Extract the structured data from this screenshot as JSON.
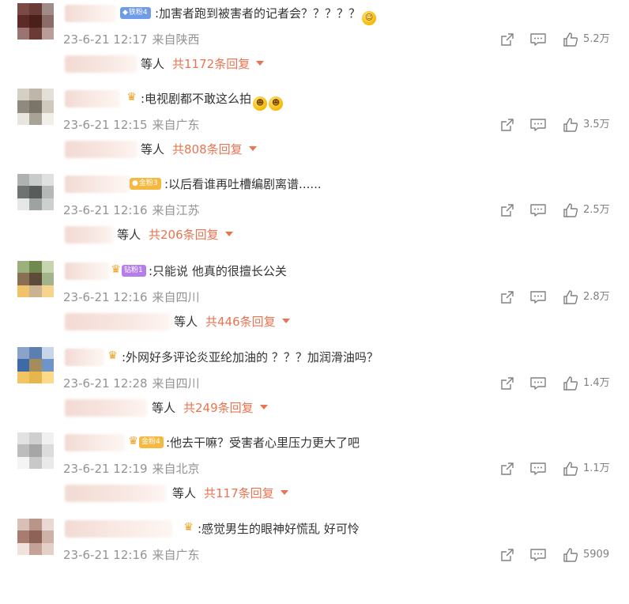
{
  "comments": [
    {
      "badge": "铁粉4",
      "badge_color": "#6f9be8",
      "badge_has_crown": false,
      "crown_only": false,
      "text": ":加害者跑到被害者的记者会？？？？？",
      "emoji": "grinning-sweat-emoji",
      "date": "23-6-21 12:17",
      "location": "来自陕西",
      "likes": "5.2万",
      "reply_prefix": "等人",
      "reply_link": "共1172条回复",
      "avatar": [
        "#7b4a44",
        "#6a3a36",
        "#a08b87",
        "#5c2b28",
        "#4b1f1c",
        "#8c6c68",
        "#9a7470",
        "#6b3a35",
        "#b89d98"
      ]
    },
    {
      "badge": "",
      "badge_color": "",
      "badge_has_crown": false,
      "crown_only": true,
      "text": ":电视剧都不敢这么拍",
      "emoji": "laughing-crying-emoji",
      "date": "23-6-21 12:15",
      "location": "来自广东",
      "likes": "3.5万",
      "reply_prefix": "等人",
      "reply_link": "共808条回复",
      "avatar": [
        "#d6d0c4",
        "#bdb6a9",
        "#e4e0d8",
        "#8f8a80",
        "#7a7568",
        "#cfc9bd",
        "#e9e6e0",
        "#a9a396",
        "#f2efea"
      ]
    },
    {
      "badge": "金粉3",
      "badge_color": "#f5b940",
      "badge_has_crown": false,
      "crown_only": false,
      "text": ":以后看谁再吐槽编剧离谱......",
      "emoji": "",
      "date": "23-6-21 12:16",
      "location": "来自江苏",
      "likes": "2.5万",
      "reply_prefix": "等人",
      "reply_link": "共206条回复",
      "avatar": [
        "#aeb2b0",
        "#c9ccca",
        "#dfe1e0",
        "#6f7472",
        "#585d5b",
        "#b4b8b6",
        "#e6e8e7",
        "#9ea3a1",
        "#cdd0cf"
      ]
    },
    {
      "badge": "钻粉1",
      "badge_color": "#b57ee8",
      "badge_has_crown": true,
      "crown_only": false,
      "text": ":只能说 他真的很擅长公关",
      "emoji": "",
      "date": "23-6-21 12:16",
      "location": "来自四川",
      "likes": "2.8万",
      "reply_prefix": "等人",
      "reply_link": "共446条回复",
      "avatar": [
        "#9bb07a",
        "#6f8a4c",
        "#c7d4b0",
        "#8a6f55",
        "#5e4a38",
        "#a3b48a",
        "#f0c36a",
        "#c9b392",
        "#f6d48c"
      ]
    },
    {
      "badge": "",
      "badge_color": "",
      "badge_has_crown": false,
      "crown_only": true,
      "text": ":外网好多评论炎亚纶加油的 ？？？加润滑油吗？",
      "emoji": "",
      "date": "23-6-21 12:28",
      "location": "来自四川",
      "likes": "1.4万",
      "reply_prefix": "等人",
      "reply_link": "共249条回复",
      "avatar": [
        "#8aa3c8",
        "#5d7fb0",
        "#c9d6e8",
        "#3f6aa8",
        "#a48d5c",
        "#6f94c8",
        "#f2c462",
        "#e6b64c",
        "#ffd98a"
      ]
    },
    {
      "badge": "金粉4",
      "badge_color": "#f5b940",
      "badge_has_crown": true,
      "crown_only": false,
      "text": ":他去干嘛？受害者心里压力更大了吧",
      "emoji": "",
      "date": "23-6-21 12:19",
      "location": "来自北京",
      "likes": "1.1万",
      "reply_prefix": "等人",
      "reply_link": "共117条回复",
      "avatar": [
        "#e2e2e2",
        "#cfcfcf",
        "#f0f0f0",
        "#bdbdbd",
        "#a6a6a6",
        "#dcdcdc",
        "#f4f4f4",
        "#c8c8c8",
        "#e9e9e9"
      ]
    },
    {
      "badge": "",
      "badge_color": "",
      "badge_has_crown": false,
      "crown_only": true,
      "text": ":感觉男生的眼神好慌乱 好可怜",
      "emoji": "",
      "date": "23-6-21 12:16",
      "location": "来自广东",
      "likes": "5909",
      "reply_prefix": "",
      "reply_link": "",
      "avatar": [
        "#d8c0b6",
        "#b8958a",
        "#ead9d2",
        "#a87c70",
        "#8e6256",
        "#cfb2a7",
        "#f0e3dd",
        "#c4a297",
        "#e5d0c8"
      ]
    }
  ]
}
